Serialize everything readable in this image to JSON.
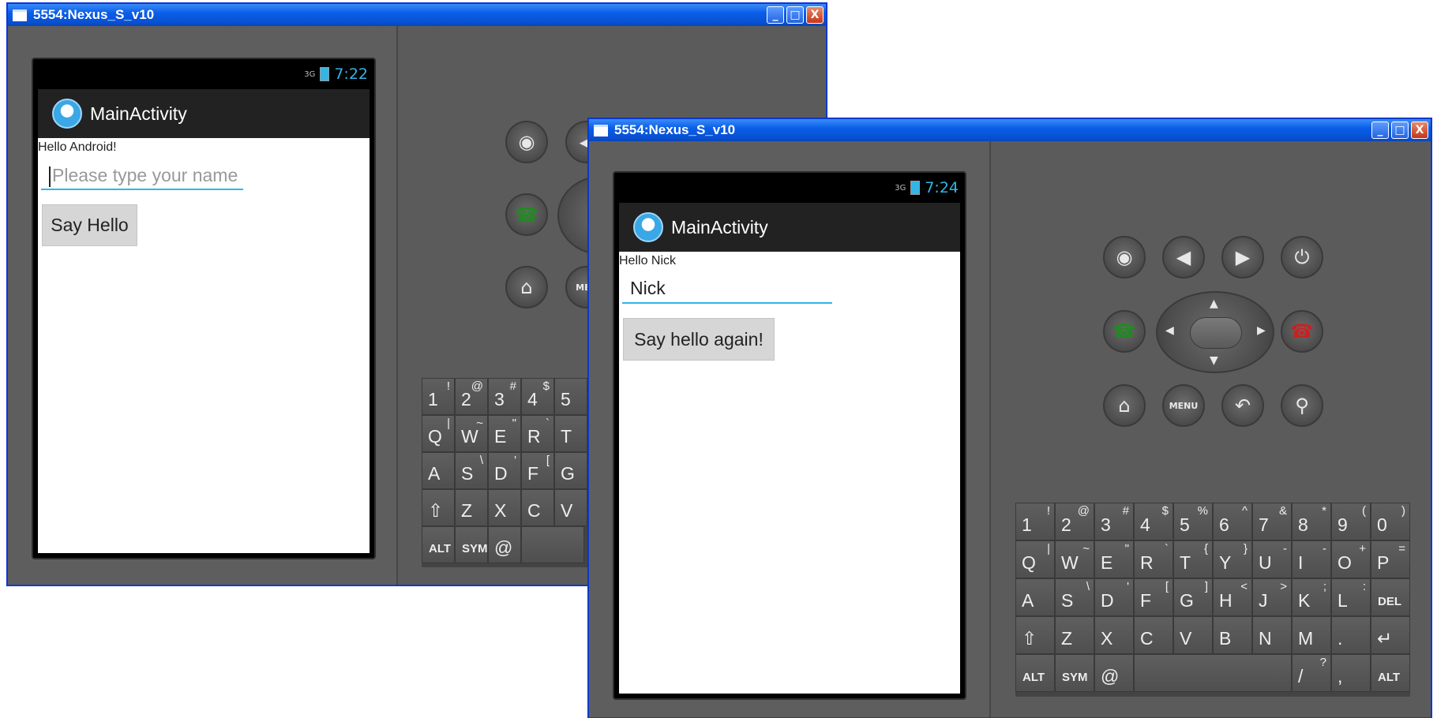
{
  "back_window": {
    "title": "5554:Nexus_S_v10",
    "status_time": "7:22",
    "signal": "3G",
    "app_title": "MainActivity",
    "greeting": "Hello Android!",
    "name_placeholder": "Please type your name",
    "button_label": "Say Hello"
  },
  "front_window": {
    "title": "5554:Nexus_S_v10",
    "status_time": "7:24",
    "signal": "3G",
    "app_title": "MainActivity",
    "greeting": "Hello Nick",
    "name_value": "Nick",
    "button_label": "Say hello again!",
    "menu_label": "MENU"
  },
  "window_buttons": {
    "minimize": "_",
    "maximize": "□",
    "close": "X"
  },
  "keyboard": {
    "row1": [
      [
        "1",
        "!"
      ],
      [
        "2",
        "@"
      ],
      [
        "3",
        "#"
      ],
      [
        "4",
        "$"
      ],
      [
        "5",
        "%"
      ],
      [
        "6",
        "^"
      ],
      [
        "7",
        "&"
      ],
      [
        "8",
        "*"
      ],
      [
        "9",
        "("
      ],
      [
        "0",
        ")"
      ]
    ],
    "row2": [
      [
        "Q",
        "|"
      ],
      [
        "W",
        "~"
      ],
      [
        "E",
        "\""
      ],
      [
        "R",
        "`"
      ],
      [
        "T",
        "{"
      ],
      [
        "Y",
        "}"
      ],
      [
        "U",
        "-"
      ],
      [
        "I",
        "-"
      ],
      [
        "O",
        "+"
      ],
      [
        "P",
        "="
      ]
    ],
    "row3": [
      [
        "A",
        ""
      ],
      [
        "S",
        "\\"
      ],
      [
        "D",
        "'"
      ],
      [
        "F",
        "["
      ],
      [
        "G",
        "]"
      ],
      [
        "H",
        "<"
      ],
      [
        "J",
        ">"
      ],
      [
        "K",
        ";"
      ],
      [
        "L",
        ":"
      ],
      [
        "DEL",
        ""
      ]
    ],
    "row4": [
      [
        "⇧",
        ""
      ],
      [
        "Z",
        ""
      ],
      [
        "X",
        ""
      ],
      [
        "C",
        ""
      ],
      [
        "V",
        ""
      ],
      [
        "B",
        ""
      ],
      [
        "N",
        ""
      ],
      [
        "M",
        ""
      ],
      [
        ".",
        ""
      ],
      [
        "↵",
        ""
      ]
    ],
    "row5": [
      [
        "ALT",
        ""
      ],
      [
        "SYM",
        ""
      ],
      [
        "@",
        ""
      ],
      [
        "",
        ""
      ],
      [
        "/",
        "?"
      ],
      [
        ",",
        ""
      ],
      [
        "ALT",
        ""
      ]
    ],
    "back_row1": [
      [
        "1",
        "!"
      ],
      [
        "2",
        "@"
      ],
      [
        "3",
        "#"
      ],
      [
        "4",
        "$"
      ],
      [
        "5",
        ""
      ]
    ],
    "back_row2": [
      [
        "Q",
        "|"
      ],
      [
        "W",
        "~"
      ],
      [
        "E",
        "\""
      ],
      [
        "R",
        "`"
      ],
      [
        "T",
        ""
      ]
    ],
    "back_row3": [
      [
        "A",
        ""
      ],
      [
        "S",
        "\\"
      ],
      [
        "D",
        "'"
      ],
      [
        "F",
        "["
      ],
      [
        "G",
        ""
      ]
    ],
    "back_row4": [
      [
        "⇧",
        ""
      ],
      [
        "Z",
        ""
      ],
      [
        "X",
        ""
      ],
      [
        "C",
        ""
      ],
      [
        "V",
        ""
      ]
    ],
    "back_row5": [
      [
        "ALT",
        ""
      ],
      [
        "SYM",
        ""
      ],
      [
        "@",
        ""
      ],
      [
        "",
        ""
      ]
    ]
  },
  "colors": {
    "accent": "#33b5e5",
    "titlebar": "#0a5ee8",
    "panel": "#5b5b5b"
  }
}
